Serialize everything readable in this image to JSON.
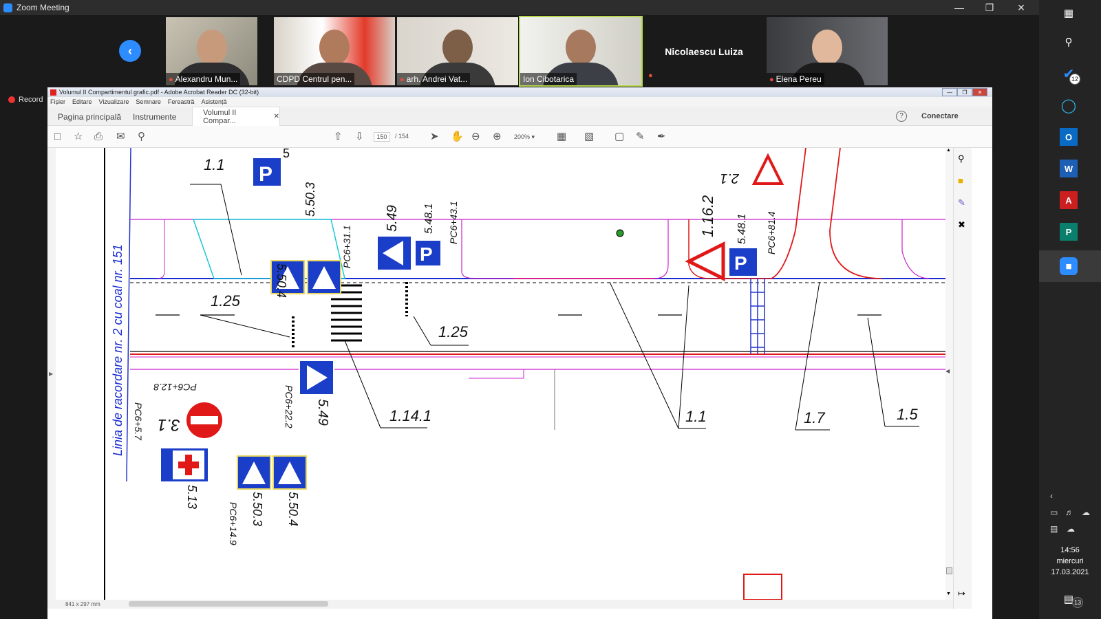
{
  "zoom": {
    "title": "Zoom Meeting",
    "record_label": "Record",
    "participants": [
      {
        "name": "Alexandru Mun..."
      },
      {
        "name": "CDPD Centrul pen..."
      },
      {
        "name": "arh. Andrei Vat..."
      },
      {
        "name": "Ion Cibotarica"
      },
      {
        "name": "Nicolaescu Luiza"
      },
      {
        "name": "Elena Pereu"
      }
    ]
  },
  "acrobat": {
    "title": "Volumul II Compartimentul grafic.pdf - Adobe Acrobat Reader DC (32-bit)",
    "menu": [
      "Fișier",
      "Editare",
      "Vizualizare",
      "Semnare",
      "Fereastră",
      "Asistență"
    ],
    "tabs": {
      "home": "Pagina principală",
      "tools": "Instrumente",
      "doc": "Volumul II Compar..."
    },
    "connect_label": "Conectare",
    "help_icon": "?",
    "page_current": "150",
    "page_total": "/ 154",
    "zoom": "200%",
    "page_size": "841 x 297 mm"
  },
  "drawing": {
    "vertical_label": "Linia de racordare nr. 2 cu coal nr. 151",
    "labels": {
      "l1": "1.1",
      "l2": "5.50.4",
      "l3": "5.50.3",
      "l4": "PC6+31.1",
      "l5": "5.49",
      "l6": "5.48.1",
      "l7": "PC6+43.1",
      "l8": "1.16.2",
      "l9": "5.48.1",
      "l10": "PC6+81.4",
      "l11": "2.1",
      "l12": "1.25",
      "l13": "1.25",
      "l14": "1.14.1",
      "l15": "1.1",
      "l16": "1.7",
      "l17": "1.5",
      "l18": "5.49",
      "l19": "PC6+22.2",
      "l20": "PC6+12.8",
      "l21": "3.1",
      "l22": "PC6+5.7",
      "l23": "5.13",
      "l24": "5.50.3",
      "l25": "5.50.4",
      "l26": "PC6+14.9",
      "l27": "5"
    },
    "sign_parking_letter": "P"
  },
  "taskbar": {
    "todo_badge": "12",
    "notif_badge": "13",
    "time": "14:56",
    "day": "miercuri",
    "date": "17.03.2021"
  }
}
